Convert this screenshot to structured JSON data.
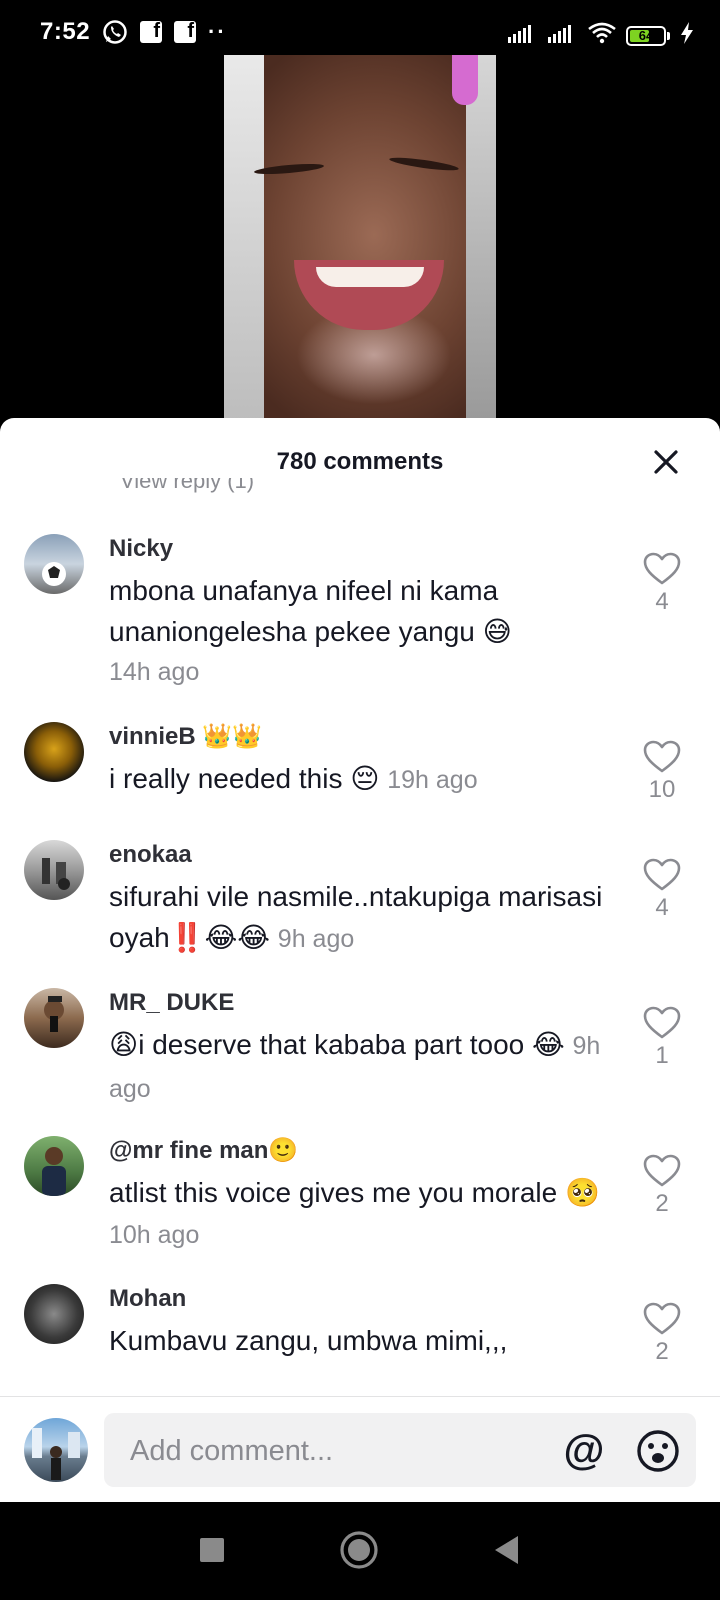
{
  "status_bar": {
    "time": "7:52",
    "battery_level": "64",
    "battery_percent": 64,
    "icons": [
      "whatsapp-icon",
      "facebook-icon",
      "facebook-icon",
      "more-dots-icon",
      "signal-icon",
      "signal-icon",
      "wifi-icon",
      "battery-icon",
      "charging-icon"
    ]
  },
  "comments_sheet": {
    "title": "780 comments",
    "cut_off_text": "View reply (1)",
    "close_icon": "close-icon",
    "comments": [
      {
        "username": "Nicky",
        "text": "mbona unafanya nifeel ni kama unaniongelesha pekee yangu 😅",
        "time": "14h ago",
        "likes": "4",
        "avatar_color": "#7a8ca0"
      },
      {
        "username": "vinnieB 👑👑",
        "text": "i really needed this 😔",
        "time": "19h ago",
        "likes": "10",
        "avatar_color": "#c49a1a"
      },
      {
        "username": "enokaa",
        "text": "sifurahi vile nasmile..ntakupiga marisasi oyah‼️😂😂",
        "time": "9h ago",
        "likes": "4",
        "avatar_color": "#8e8e8e"
      },
      {
        "username": "MR_ DUKE",
        "text": "😩i deserve that kababa part tooo 😂",
        "time": "9h ago",
        "likes": "1",
        "avatar_color": "#a0724e"
      },
      {
        "username": "@mr fine man🙂",
        "text": "atlist this voice gives me you morale 🥺",
        "time": "10h ago",
        "likes": "2",
        "avatar_color": "#4d7a44"
      },
      {
        "username": "Mohan",
        "text": "Kumbavu zangu, umbwa mimi,,,",
        "time": "",
        "likes": "2",
        "avatar_color": "#3a3a3a"
      }
    ]
  },
  "composer": {
    "placeholder": "Add comment...",
    "mention_label": "@",
    "emoji_icon": "emoji-icon"
  },
  "nav_bar": {
    "buttons": [
      "recents-square-icon",
      "home-circle-icon",
      "back-triangle-icon"
    ]
  }
}
